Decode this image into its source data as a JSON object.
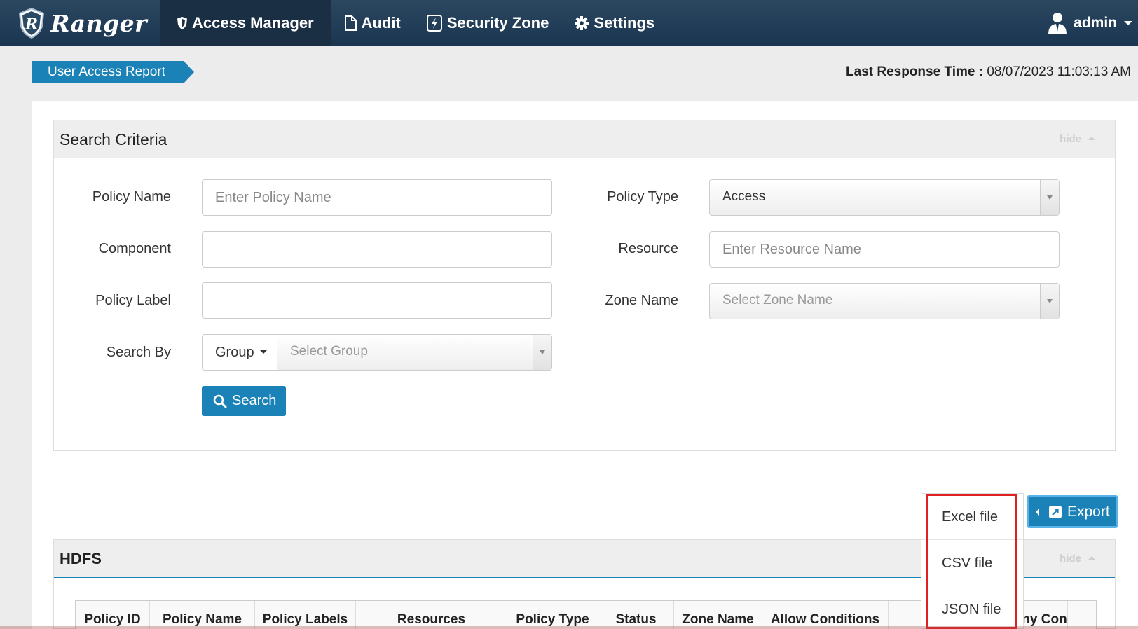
{
  "app": {
    "brand": "Ranger"
  },
  "nav": {
    "items": [
      {
        "label": "Access Manager",
        "icon": "shield-icon"
      },
      {
        "label": "Audit",
        "icon": "file-icon"
      },
      {
        "label": "Security Zone",
        "icon": "bolt-icon"
      },
      {
        "label": "Settings",
        "icon": "gear-icon"
      }
    ],
    "user": "admin"
  },
  "breadcrumb": "User Access Report",
  "last_response": {
    "label": "Last Response Time :",
    "value": "08/07/2023 11:03:13 AM"
  },
  "search": {
    "title": "Search Criteria",
    "hide": "hide",
    "fields": {
      "policy_name": {
        "label": "Policy Name",
        "placeholder": "Enter Policy Name"
      },
      "component": {
        "label": "Component",
        "value": ""
      },
      "policy_label": {
        "label": "Policy Label",
        "value": ""
      },
      "search_by": {
        "label": "Search By",
        "mode": "Group",
        "placeholder": "Select Group"
      },
      "policy_type": {
        "label": "Policy Type",
        "value": "Access"
      },
      "resource": {
        "label": "Resource",
        "placeholder": "Enter Resource Name"
      },
      "zone_name": {
        "label": "Zone Name",
        "placeholder": "Select Zone Name"
      }
    },
    "button": "Search"
  },
  "export": {
    "button": "Export",
    "options": [
      "Excel file",
      "CSV file",
      "JSON file"
    ]
  },
  "hdfs": {
    "title": "HDFS",
    "hide": "hide",
    "columns": [
      "Policy ID",
      "Policy Name",
      "Policy Labels",
      "Resources",
      "Policy Type",
      "Status",
      "Zone Name",
      "Allow Conditions",
      "",
      "Deny Con"
    ]
  },
  "colors": {
    "navbar": "#1a3550",
    "accent": "#1a82b6",
    "highlight": "#e02020"
  }
}
